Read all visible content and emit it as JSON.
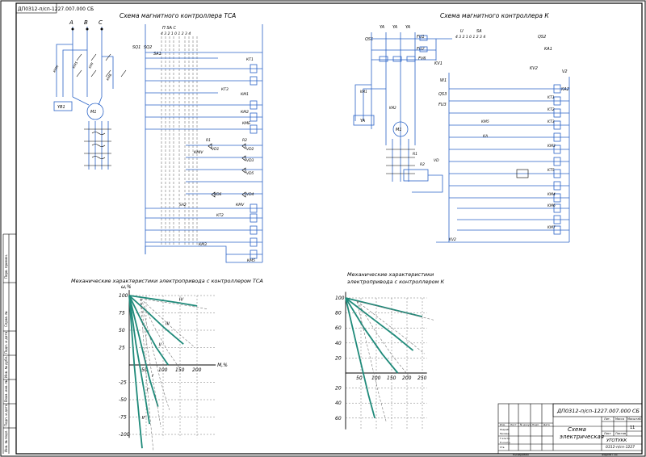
{
  "stamp_top": "ДП0312-п/сп-1227.007.000 СБ",
  "tsa_title": "Схема магнитного контроллера ТСА",
  "k_title": "Схема магнитного контроллера К",
  "chart_tsa_title": "Механические характеристики электропривода с контроллером ТСА",
  "chart_k_title_1": "Механические характеристики",
  "chart_k_title_2": "электропривода с контроллером К",
  "phases": [
    "A",
    "B",
    "C"
  ],
  "labels_tsa": {
    "yb1": "YB1",
    "m1": "M1",
    "kt1": "КТ1",
    "kt2": "КТ2",
    "kt3": "КТ3",
    "km1": "КМ1",
    "km2": "КМ2",
    "sa1": "SA1",
    "sa2": "SA2",
    "sq1": "SQ1",
    "sq2": "SQ2",
    "kmb": "КМБ",
    "kmh": "КМН",
    "km5": "КМ5",
    "kmiv": "КМIV",
    "kmv": "КМV",
    "km3": "КМ3",
    "vd1": "VD1",
    "vd2": "VD2",
    "vd3": "VD3",
    "vd4": "VD4",
    "vd5": "VD5",
    "vd6": "VD6",
    "r1": "R1",
    "r2": "R2",
    "controller_head": "П  SA  С",
    "controller_nums": "4 3 2 1  0  1 2 3 4"
  },
  "labels_k": {
    "ya": "YA",
    "qs1": "QS1",
    "qs2": "QS2",
    "fu1": "FU1",
    "fu2": "FU2",
    "fu3": "FU3",
    "fv6": "FV6",
    "kv1": "KV1",
    "kv2": "KV2",
    "ka1": "KA1",
    "ka2": "KA2",
    "qs3": "QS3",
    "km1": "KM1",
    "km2": "KM2",
    "km3": "KM3",
    "km4": "KM4",
    "km5": "KM5",
    "km6": "KM6",
    "km7": "KM7",
    "kt1": "KT1",
    "kt2": "KT2",
    "kt3": "KT3",
    "kt5": "KT5",
    "m1": "M1",
    "r1": "R1",
    "r2": "R2",
    "vd": "VD",
    "ka": "KA",
    "w1": "W1",
    "v2": "V2",
    "u": "U",
    "sa": "SA",
    "controller_nums": "4 3 2 1 0 1 2 3 4"
  },
  "chart_data": [
    {
      "type": "line",
      "title": "Механические характеристики электропривода с контроллером ТСА",
      "ylabel": "ω,%",
      "xlabel": "M,%",
      "x_ticks": [
        "50",
        "100",
        "150",
        "200"
      ],
      "y_ticks": [
        "100",
        "75",
        "50",
        "25",
        "-25",
        "-50",
        "-75",
        "-100"
      ],
      "series_labels": [
        "IV",
        "III",
        "II",
        "I",
        "I'",
        "II'",
        "III'",
        "IV'",
        "V'",
        "VI'"
      ],
      "series": [
        {
          "name": "IV",
          "values": [
            [
              0,
              100
            ],
            [
              70,
              95
            ],
            [
              140,
              90
            ],
            [
              200,
              85
            ]
          ]
        },
        {
          "name": "III",
          "values": [
            [
              0,
              100
            ],
            [
              50,
              78
            ],
            [
              100,
              55
            ],
            [
              160,
              30
            ]
          ]
        },
        {
          "name": "II",
          "values": [
            [
              0,
              100
            ],
            [
              40,
              60
            ],
            [
              80,
              25
            ],
            [
              115,
              0
            ]
          ]
        },
        {
          "name": "I",
          "values": [
            [
              0,
              100
            ],
            [
              30,
              40
            ],
            [
              60,
              -20
            ],
            [
              85,
              -60
            ]
          ]
        },
        {
          "name": "I'",
          "values": [
            [
              0,
              100
            ],
            [
              20,
              30
            ],
            [
              45,
              -40
            ],
            [
              60,
              -85
            ]
          ]
        },
        {
          "name": "II'",
          "values": [
            [
              0,
              100
            ],
            [
              15,
              0
            ],
            [
              30,
              -80
            ],
            [
              38,
              -120
            ]
          ]
        }
      ]
    },
    {
      "type": "line",
      "title": "Механические характеристики электропривода с контроллером К",
      "x_ticks": [
        "50",
        "100",
        "150",
        "200",
        "250"
      ],
      "y_ticks": [
        "100",
        "80",
        "60",
        "40",
        "20",
        "20",
        "40",
        "60"
      ],
      "series": [
        {
          "name": "1",
          "values": [
            [
              0,
              100
            ],
            [
              100,
              90
            ],
            [
              200,
              80
            ],
            [
              250,
              75
            ]
          ]
        },
        {
          "name": "2",
          "values": [
            [
              0,
              100
            ],
            [
              80,
              75
            ],
            [
              160,
              50
            ],
            [
              220,
              30
            ]
          ]
        },
        {
          "name": "3",
          "values": [
            [
              0,
              100
            ],
            [
              60,
              60
            ],
            [
              120,
              25
            ],
            [
              170,
              0
            ]
          ]
        },
        {
          "name": "4",
          "values": [
            [
              0,
              100
            ],
            [
              40,
              30
            ],
            [
              75,
              -30
            ],
            [
              95,
              -60
            ]
          ]
        }
      ]
    }
  ],
  "title_block": {
    "doc_code": "ДП0312-п/сп-1227.007.000 СБ",
    "doc_name_1": "Схема",
    "doc_name_2": "электрическая",
    "sheet_num": "11",
    "org_1": "УГОТУКК",
    "org_2": "0312-п/сп-1227",
    "h_lit": "Лит.",
    "h_mass": "Масса",
    "h_scale": "Масштаб",
    "h_list": "Лист",
    "h_lists": "Листов",
    "footer_copy": "Копировал",
    "footer_format": "Формат    А1",
    "cols": [
      "Изм.",
      "Лист",
      "№ докум.",
      "Подп.",
      "Дата"
    ],
    "rows": [
      "Разраб.",
      "Провер.",
      "Т.контр.",
      "Н.контр.",
      "Утв."
    ]
  },
  "side_labels": [
    "Перв. примен.",
    "Справ. №",
    "Подп. и дата",
    "Инв. № дубл.",
    "Взам. инв. №",
    "Подп. и дата",
    "Инв. № подл."
  ]
}
